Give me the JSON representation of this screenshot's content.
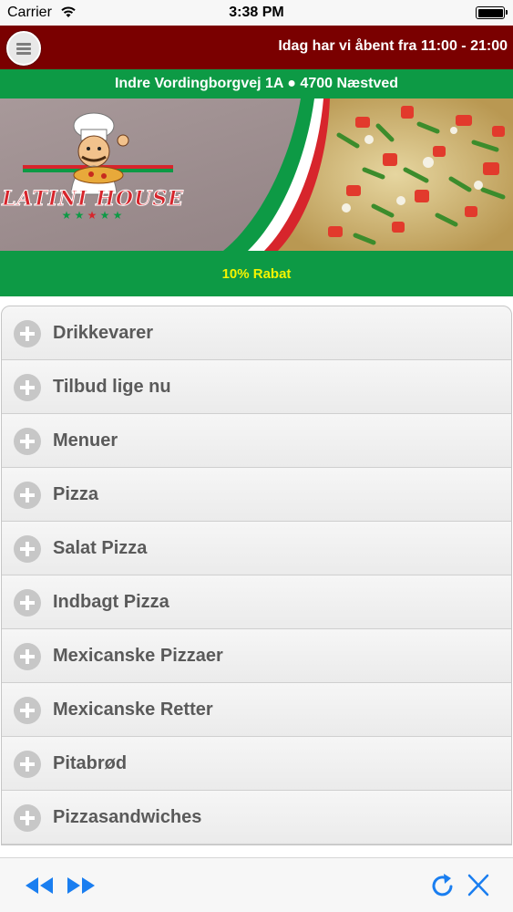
{
  "status_bar": {
    "carrier": "Carrier",
    "time": "3:38 PM"
  },
  "header": {
    "hours_text": "Idag har vi åbent fra 11:00 - 21:00",
    "address": "Indre Vordingborgvej 1A ● 4700 Næstved"
  },
  "banner": {
    "logo_text": "LATINI HOUSE"
  },
  "discount_text": "10% Rabat",
  "categories": [
    {
      "label": "Drikkevarer"
    },
    {
      "label": "Tilbud lige nu"
    },
    {
      "label": "Menuer"
    },
    {
      "label": "Pizza"
    },
    {
      "label": "Salat Pizza"
    },
    {
      "label": "Indbagt Pizza"
    },
    {
      "label": "Mexicanske Pizzaer"
    },
    {
      "label": "Mexicanske Retter"
    },
    {
      "label": "Pitabrød"
    },
    {
      "label": "Pizzasandwiches"
    }
  ],
  "colors": {
    "header_red": "#7a0000",
    "italian_green": "#0d9a45",
    "discount_yellow": "#f4f400",
    "toolbar_blue": "#1a7ef0"
  },
  "icons": {
    "menu": "hamburger-menu-icon",
    "category": "plus-circle-icon",
    "back": "rewind-icon",
    "forward": "fast-forward-icon",
    "refresh": "refresh-icon",
    "close": "close-icon"
  }
}
